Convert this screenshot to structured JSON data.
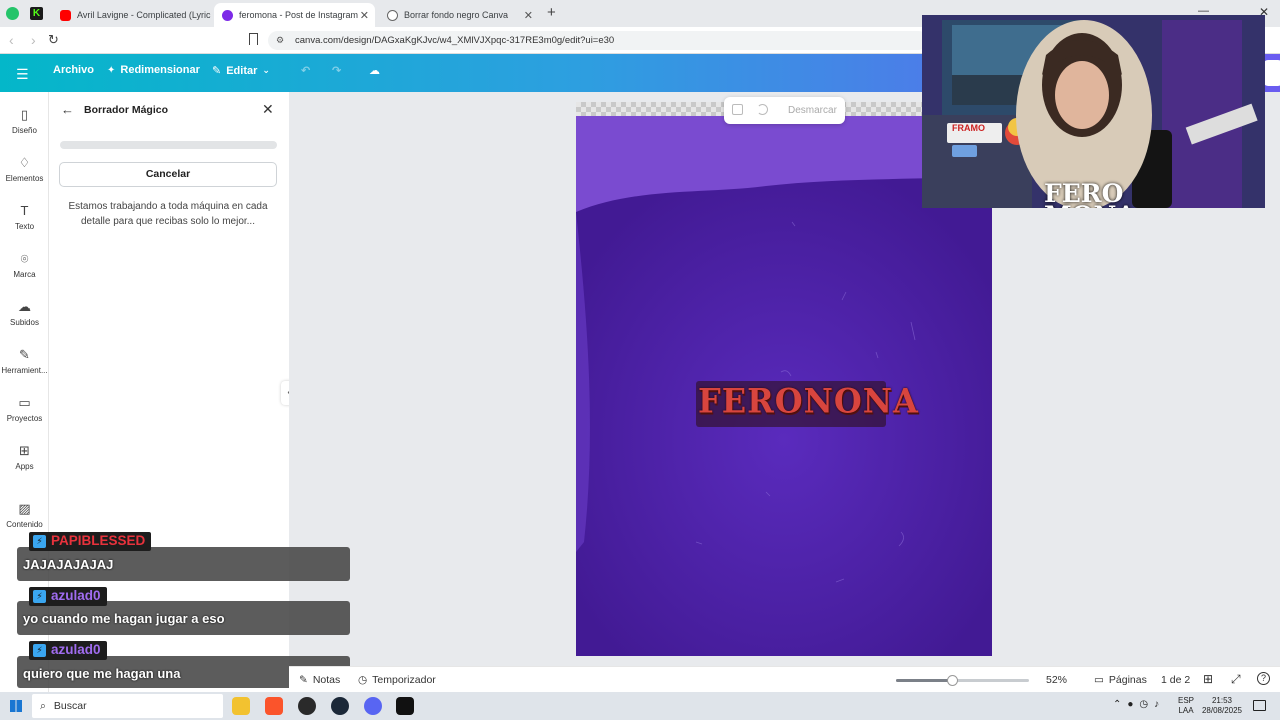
{
  "browser": {
    "tabs": [
      {
        "title": "Avril Lavigne - Complicated (Lyric",
        "active": false
      },
      {
        "title": "feromona - Post de Instagram",
        "active": true
      },
      {
        "title": "Borrar fondo negro Canva",
        "active": false
      }
    ],
    "new_tab": "+",
    "url": "canva.com/design/DAGxaKgKJvc/w4_XMlVJXpqc-317RE3m0g/edit?ui=e30"
  },
  "header": {
    "archivo": "Archivo",
    "redimensionar": "Redimensionar",
    "editar": "Editar"
  },
  "rail": {
    "items": [
      "Diseño",
      "Elementos",
      "Texto",
      "Marca",
      "Subidos",
      "Herramient...",
      "Proyectos",
      "Apps",
      "Contenido"
    ]
  },
  "panel": {
    "title": "Borrador Mágico",
    "cancel": "Cancelar",
    "message": "Estamos trabajando a toda máquina en cada detalle para que recibas solo lo mejor..."
  },
  "floatbar": {
    "desmarcar": "Desmarcar"
  },
  "artboard": {
    "logo_text": "FERONONA"
  },
  "webcam": {
    "overlay_text": "FERO MONA",
    "shelf_sign": "FRAMO"
  },
  "chat": [
    {
      "user": "PAPIBLESSED",
      "message": "JAJAJAJAJAJ",
      "color": "#e8323c"
    },
    {
      "user": "azulad0",
      "message": "yo cuando me hagan jugar a eso",
      "color": "#a06cf0"
    },
    {
      "user": "azulad0",
      "message": "quiero que me hagan una",
      "color": "#a06cf0"
    }
  ],
  "bottombar": {
    "notas": "Notas",
    "temporizador": "Temporizador",
    "zoom": "52%",
    "paginas": "Páginas",
    "page_count": "1 de 2"
  },
  "taskbar": {
    "search": "Buscar",
    "lang": "ESP",
    "lang2": "LAA",
    "time": "21:53",
    "date": "28/08/2025"
  },
  "colors": {
    "artboard_purple": "#4e1fa8",
    "artboard_light": "#7a4bd0",
    "header_start": "#04b7c9",
    "header_end": "#6a5cf0"
  }
}
